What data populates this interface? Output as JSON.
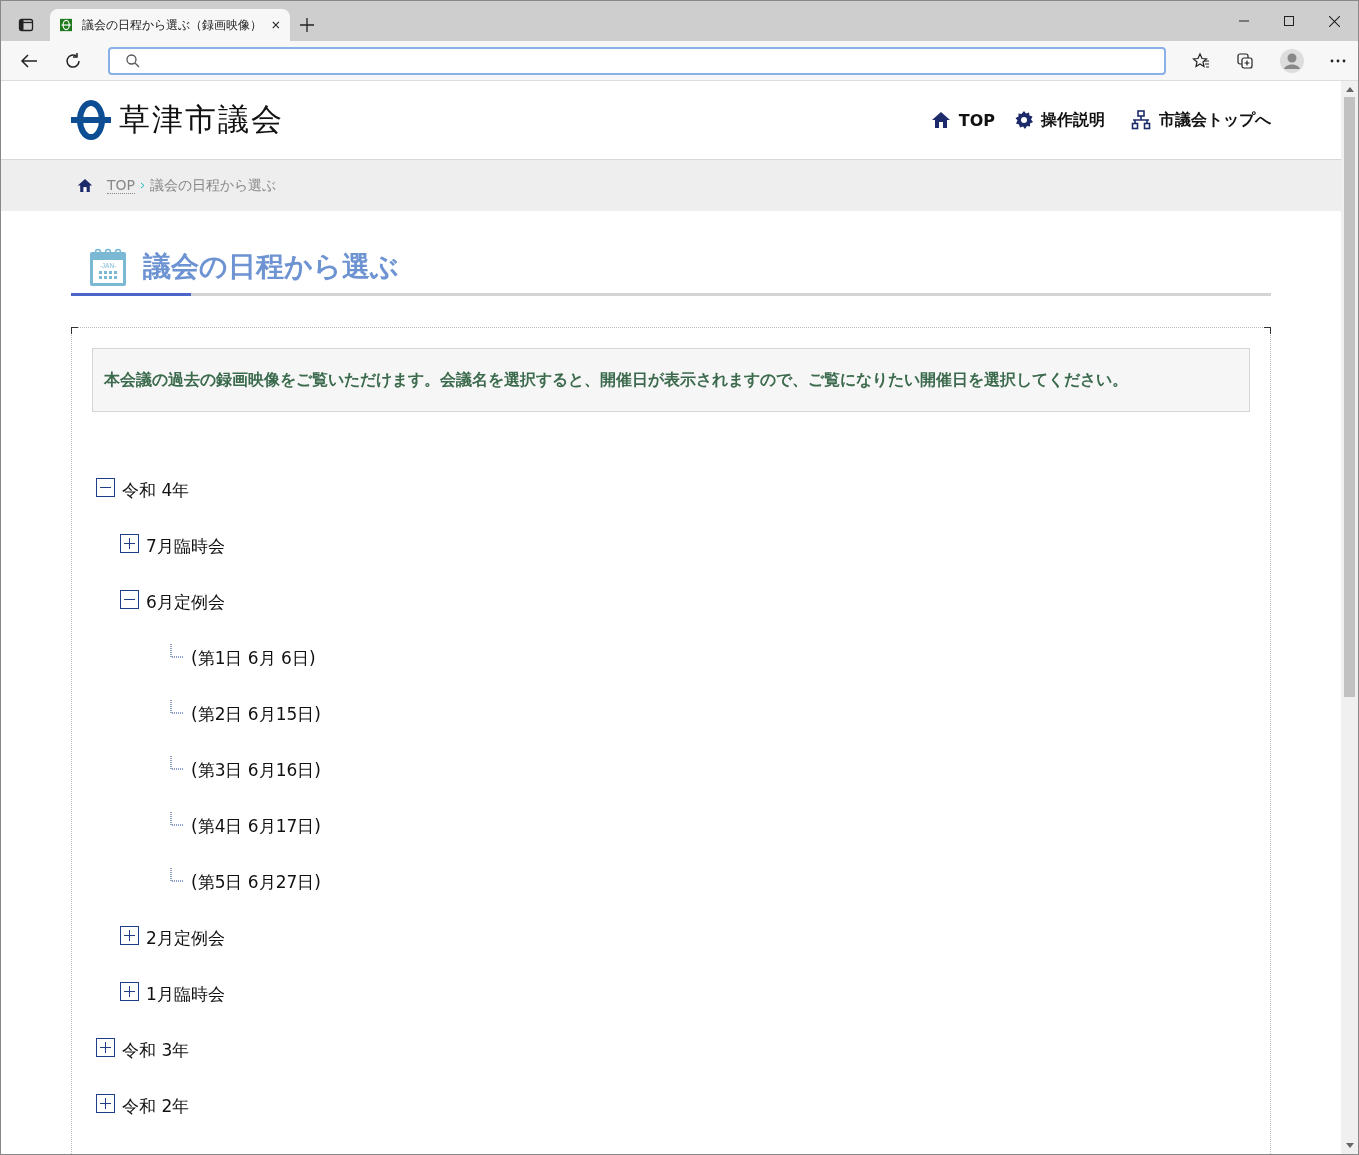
{
  "browser": {
    "tab_title": "議会の日程から選ぶ（録画映像）"
  },
  "header": {
    "logo_text": "草津市議会",
    "nav": [
      {
        "kind": "home",
        "label": "TOP"
      },
      {
        "kind": "gear",
        "label": "操作説明"
      },
      {
        "kind": "sitemap",
        "label": "市議会トップへ"
      }
    ]
  },
  "breadcrumb": {
    "items": [
      "TOP",
      "議会の日程から選ぶ"
    ]
  },
  "page_title": "議会の日程から選ぶ",
  "calendar_icon_text": "-JAN-",
  "notice": "本会議の過去の録画映像をご覧いただけます。会議名を選択すると、開催日が表示されますので、ご覧になりたい開催日を選択してください。",
  "tree": [
    {
      "label": "令和 4年",
      "expanded": true,
      "children": [
        {
          "label": "7月臨時会",
          "expanded": false
        },
        {
          "label": "6月定例会",
          "expanded": true,
          "children": [
            {
              "label": "(第1日 6月 6日)"
            },
            {
              "label": "(第2日 6月15日)"
            },
            {
              "label": "(第3日 6月16日)"
            },
            {
              "label": "(第4日 6月17日)"
            },
            {
              "label": "(第5日 6月27日)"
            }
          ]
        },
        {
          "label": "2月定例会",
          "expanded": false
        },
        {
          "label": "1月臨時会",
          "expanded": false
        }
      ]
    },
    {
      "label": "令和 3年",
      "expanded": false
    },
    {
      "label": "令和 2年",
      "expanded": false
    }
  ]
}
